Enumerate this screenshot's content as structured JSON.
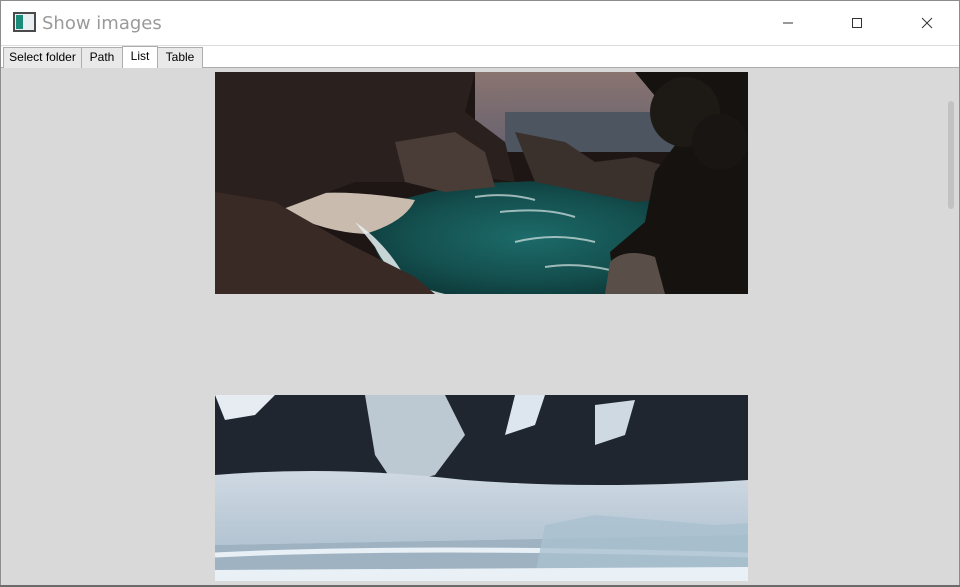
{
  "window": {
    "title": "Show images",
    "icon": "app-image-icon",
    "controls": [
      "minimize-icon",
      "maximize-icon",
      "close-icon"
    ]
  },
  "tabs": [
    {
      "label": "Select folder",
      "active": false
    },
    {
      "label": "Path",
      "active": false
    },
    {
      "label": "List",
      "active": true
    },
    {
      "label": "Table",
      "active": false
    }
  ],
  "images": [
    {
      "subject": "coastal cove with turquoise water and waterfall"
    },
    {
      "subject": "snow-covered mountains and glacier"
    }
  ],
  "scroll_position": 0.12
}
